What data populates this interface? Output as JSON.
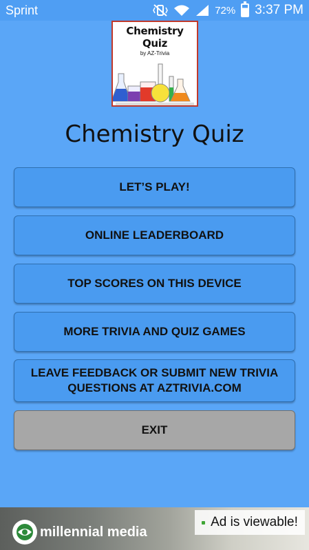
{
  "status_bar": {
    "carrier": "Sprint",
    "battery": "72%",
    "time": "3:37 PM",
    "icons": [
      "mute-vibrate-icon",
      "wifi-icon",
      "signal-icon",
      "battery-icon"
    ]
  },
  "logo": {
    "title": "Chemistry Quiz",
    "subtitle": "by AZ-Trivia"
  },
  "app_title": "Chemistry Quiz",
  "menu": {
    "play": "LET’S PLAY!",
    "leaderboard": "ONLINE LEADERBOARD",
    "top_scores": "TOP SCORES ON THIS DEVICE",
    "more_games": "MORE TRIVIA AND QUIZ GAMES",
    "feedback": "LEAVE FEEDBACK OR SUBMIT NEW TRIVIA QUESTIONS AT AZTRIVIA.COM",
    "exit": "EXIT"
  },
  "ad": {
    "brand": "millennial media",
    "label": "Ad is viewable!"
  },
  "colors": {
    "background": "#5aa6f7",
    "button": "#4a9bf0",
    "exit_button": "#a7a7a7"
  }
}
